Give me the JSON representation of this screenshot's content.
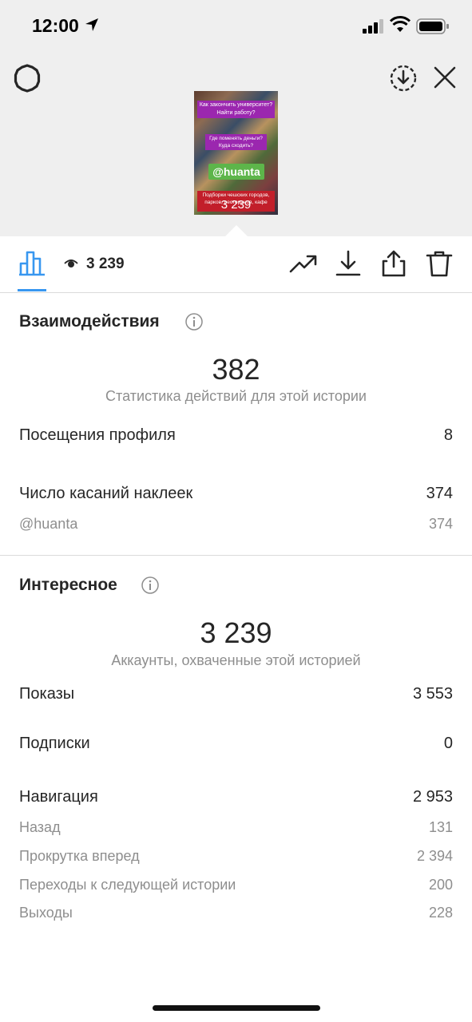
{
  "status_bar": {
    "time": "12:00"
  },
  "preview": {
    "text_1": "Как закончить университет? Найти работу?",
    "text_2": "Где поменять деньги? Куда сходить?",
    "handle": "@huanta",
    "text_4": "Подборки чешских городов, парков, ресторанов, кафе",
    "count": "3 239"
  },
  "toolbar": {
    "views": "3 239"
  },
  "interactions": {
    "title": "Взаимодействия",
    "total": "382",
    "caption": "Статистика действий для этой истории",
    "rows": [
      {
        "label": "Посещения профиля",
        "value": "8"
      },
      {
        "label": "Число касаний наклеек",
        "value": "374"
      }
    ],
    "sub_rows": [
      {
        "label": "@huanta",
        "value": "374"
      }
    ]
  },
  "discovery": {
    "title": "Интересное",
    "total": "3 239",
    "caption": "Аккаунты, охваченные этой историей",
    "rows": [
      {
        "label": "Показы",
        "value": "3 553"
      },
      {
        "label": "Подписки",
        "value": "0"
      },
      {
        "label": "Навигация",
        "value": "2 953"
      }
    ],
    "sub_rows": [
      {
        "label": "Назад",
        "value": "131"
      },
      {
        "label": "Прокрутка вперед",
        "value": "2 394"
      },
      {
        "label": "Переходы к следующей истории",
        "value": "200"
      },
      {
        "label": "Выходы",
        "value": "228"
      }
    ]
  },
  "colors": {
    "accent": "#3897f0",
    "text": "#262626",
    "secondary": "#8e8e8e",
    "header_bg": "#efefef"
  },
  "icons": [
    "location-arrow-icon",
    "signal-icon",
    "wifi-icon",
    "battery-icon",
    "gear-icon",
    "download-circle-icon",
    "close-icon",
    "bar-chart-icon",
    "eye-icon",
    "trending-icon",
    "download-icon",
    "share-icon",
    "trash-icon",
    "info-icon"
  ]
}
